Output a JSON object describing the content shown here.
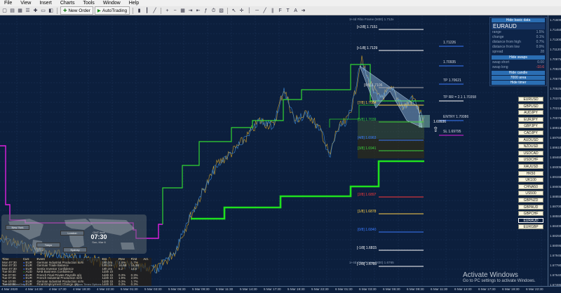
{
  "menu": [
    "File",
    "View",
    "Insert",
    "Charts",
    "Tools",
    "Window",
    "Help"
  ],
  "toolbar": {
    "new_order": "New Order",
    "auto_trading": "AutoTrading"
  },
  "icons": [
    "new-chart-icon",
    "open-icon",
    "profiles-icon",
    "market-watch-icon",
    "navigator-icon",
    "terminal-icon",
    "tester-icon",
    "new-order-icon",
    "autotrading-icon",
    "bar-chart-icon",
    "candle-chart-icon",
    "line-chart-icon",
    "zoom-in-icon",
    "zoom-out-icon",
    "tile-icon",
    "autoscroll-icon",
    "shift-icon",
    "indicators-icon",
    "periods-icon",
    "templates-icon",
    "cursor-icon",
    "crosshair-icon",
    "vline-icon",
    "hline-icon",
    "trendline-icon",
    "channel-icon",
    "fibo-icon",
    "text-icon",
    "label-icon",
    "arrow-icon"
  ],
  "chart": {
    "top_note": "1+4d Fibo Frame (M30) 1.712x",
    "bottom_note": "1+4d Fibo Frame (M30) 1.6765",
    "fib_levels": [
      {
        "label": "[+2/8] 1.7151",
        "color": "#ffffff"
      },
      {
        "label": "[+1/8] 1.7129",
        "color": "#ffffff"
      },
      {
        "label": "[8/8] 1.7106",
        "color": "#aaaaaa"
      },
      {
        "label": "[7/8] 1.7084",
        "color": "#ffd24a"
      },
      {
        "label": "[6/8] 1.7061",
        "color": "#ff3a3a"
      },
      {
        "label": "[5/8] 1.7039",
        "color": "#3cd43c"
      },
      {
        "label": "[4/8] 1.6963",
        "color": "#3a7bff"
      },
      {
        "label": "[3/8] 1.6941",
        "color": "#3cd43c"
      },
      {
        "label": "[2/8] 1.6897",
        "color": "#ff3a3a"
      },
      {
        "label": "[1/8] 1.6878",
        "color": "#ffd24a"
      },
      {
        "label": "[0/8] 1.6840",
        "color": "#3a7bff"
      },
      {
        "label": "[-1/8] 1.6815",
        "color": "#ffffff"
      },
      {
        "label": "[-2/8] 1.6785",
        "color": "#ffffff"
      }
    ],
    "target_labels": [
      {
        "label": "1.71226"
      },
      {
        "label": "1.70935"
      },
      {
        "label": "TP 1.70621"
      },
      {
        "label": "TP RR = 2.1 1.70358"
      },
      {
        "label": "ENTRY 1.70086"
      },
      {
        "label": "SL 1.69795"
      }
    ],
    "current_price_marker": "1.69936"
  },
  "panel": {
    "hide_basic": "Hide basic data",
    "pair": "EURAUD",
    "rows": [
      {
        "k": "range",
        "v": "1.5%"
      },
      {
        "k": "change",
        "v": "0.1%"
      },
      {
        "k": "distance from high",
        "v": "0.7%"
      },
      {
        "k": "distance from low",
        "v": "0.9%"
      },
      {
        "k": "spread",
        "v": "28"
      },
      {
        "k": "swap short",
        "v": "0.00"
      },
      {
        "k": "swap long",
        "v": "-10.6"
      }
    ],
    "hide_swaps": "Hide swaps",
    "hide_candle": "Hide candle",
    "timer_zone": "7000 area",
    "hide_timer": "Hide timer"
  },
  "symbols": [
    "EURUSD",
    "GBPUSD",
    "AUDJPY",
    "EURJPY",
    "GBPJPY",
    "CADJPY",
    "AUDUSD",
    "NZDUSD",
    "USDCAD",
    "USDCHF",
    "XAUUSD",
    "HK50",
    "UK100",
    "CHNA50",
    "US500",
    "GBPNZD",
    "GBPAUD",
    "GBPCHF",
    "EURAUD",
    "EURGBP"
  ],
  "active_symbol": "EURAUD",
  "clock": {
    "label": "GMT time",
    "time": "07:30",
    "sub": "Sun, Mar 6"
  },
  "world_labels": [
    "New York",
    "London",
    "Tokyo",
    "Sydney"
  ],
  "news": {
    "headers": [
      "Time",
      "Curr.",
      "Event",
      "Est.",
      "Prev",
      "First",
      "Act."
    ],
    "rows": [
      [
        "Mon 07:30",
        "EUR",
        "German Industrial Production m/m",
        "19h 2m",
        "1.4%",
        "1.7%",
        ""
      ],
      [
        "Mon 07:30",
        "EUR",
        "German Trade Balance",
        "19h 2m",
        "16.6B",
        "16.3B",
        ""
      ],
      [
        "Mon 07:30",
        "EUR",
        "Sentix Investor Confidence",
        "19h 2m",
        "5.2",
        "14.0",
        ""
      ],
      [
        "Tue 00:30",
        "AUD",
        "NAB Business Confidence",
        "1d4h 1h",
        "",
        "",
        ""
      ],
      [
        "Tue 07:00",
        "EUR",
        "French Final Private Payrolls q/q",
        "1d4h 1h",
        "0.3%",
        "0.3%",
        ""
      ],
      [
        "Tue 07:45",
        "EUR",
        "French Industrial Production m/m",
        "1d4h 1h",
        "1.9%",
        "2.8%",
        ""
      ],
      [
        "Tue 10:00",
        "EUR",
        "German Industrial Production m/m",
        "1d4h 1h",
        "0.3%",
        "1.7%",
        ""
      ],
      [
        "Tue 10:00",
        "EUR",
        "Final Employment Change q/q",
        "1d4h 1h",
        "0.3%",
        "0.3%",
        ""
      ],
      [
        "Tue 10:00",
        "EUR",
        "Revised GDP q/q",
        "1d4h 1h",
        "0.3%",
        "0.3%",
        ""
      ],
      [
        "Tue 10:00",
        "EUR",
        "BER Deputy Gov Schnabel Speaks",
        "1d4h 1h",
        "",
        "",
        ""
      ]
    ],
    "footer": [
      "Switch News/Only",
      "Show Times Options"
    ]
  },
  "time_axis": [
    "4 Mar 2020",
    "4 Mar 14:30",
    "4 Mar 17:30",
    "4 Mar 19:30",
    "4 Mar 22:30",
    "5 Mar 01:30",
    "5 Mar 03:30",
    "5 Mar 06:30",
    "5 Mar 09:30",
    "5 Mar 11:30",
    "5 Mar 14:30",
    "5 Mar 17:30",
    "5 Mar 19:30",
    "5 Mar 22:30",
    "6 Mar 01:30",
    "6 Mar 03:30",
    "6 Mar 06:30",
    "6 Mar 09:30",
    "6 Mar 11:30",
    "6 Mar 14:30",
    "6 Mar 17:30",
    "6 Mar 19:30",
    "6 Mar 22:30"
  ],
  "price_axis": [
    "1.71600",
    "1.71450",
    "1.71300",
    "1.71120",
    "1.70975",
    "1.70820",
    "1.70670",
    "1.70525",
    "1.70370",
    "1.70215",
    "1.70070",
    "1.69915",
    "1.69760",
    "1.69610",
    "1.69460",
    "1.69305",
    "1.69155",
    "1.69005",
    "1.68855",
    "1.68700",
    "1.68550",
    "1.68400",
    "1.68250",
    "1.68095",
    "1.67945",
    "1.67790",
    "1.67640",
    "1.67495"
  ],
  "watermark": {
    "title": "Activate Windows",
    "sub": "Go to PC settings to activate Windows."
  }
}
